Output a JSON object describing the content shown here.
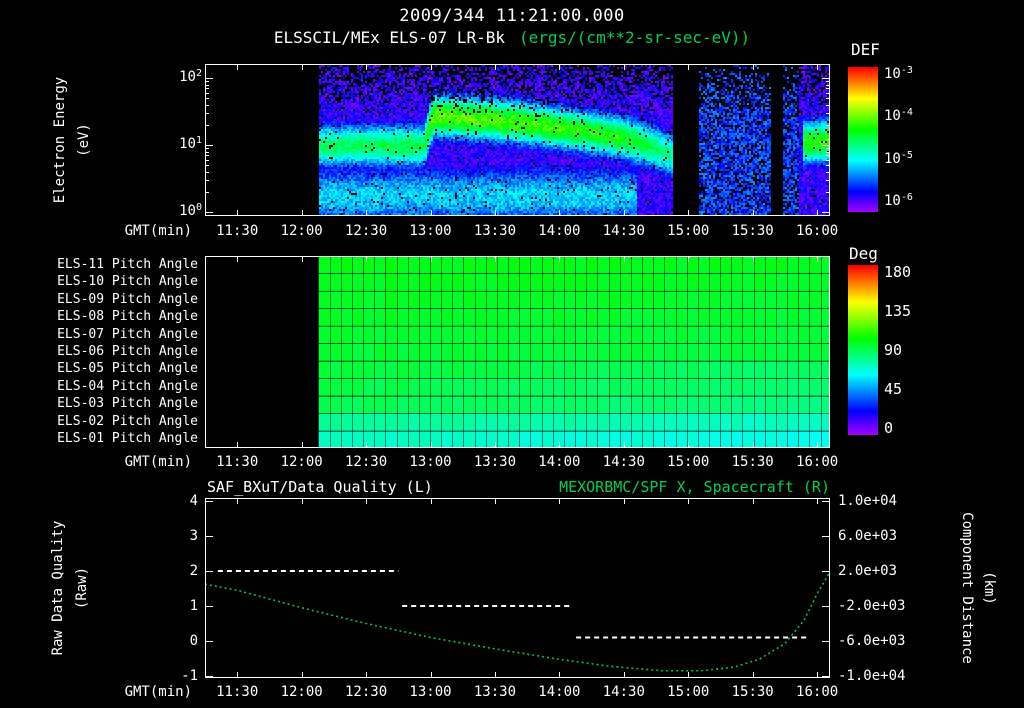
{
  "colors": {
    "background": "#000000",
    "text": "#ffffff",
    "accent_green": "#00cf50",
    "curve_green": "#00c24a",
    "quality_line": "#ffffff"
  },
  "header": {
    "title": "2009/344 11:21:00.000",
    "instrument": "ELSSCIL/MEx ELS-07 LR-Bk",
    "units": "(ergs/(cm**2-sr-sec-eV))"
  },
  "time_axis": {
    "label": "GMT(min)",
    "ticks": [
      "11:30",
      "12:00",
      "12:30",
      "13:00",
      "13:30",
      "14:00",
      "14:30",
      "15:00",
      "15:30",
      "16:00"
    ],
    "tick_hours": [
      11.5,
      12.0,
      12.5,
      13.0,
      13.5,
      14.0,
      14.5,
      15.0,
      15.5,
      16.0
    ],
    "start_hour": 11.25,
    "end_hour": 16.1
  },
  "spectrogram_panel": {
    "ylabel_line1": "Electron Energy",
    "ylabel_line2": "(eV)",
    "yticks": [
      {
        "b": "10",
        "e": "2",
        "logE": 2
      },
      {
        "b": "10",
        "e": "1",
        "logE": 1
      },
      {
        "b": "10",
        "e": "0",
        "logE": 0
      }
    ],
    "colorbar": {
      "title": "DEF",
      "ticks": [
        {
          "b": "10",
          "e": "-3"
        },
        {
          "b": "10",
          "e": "-4"
        },
        {
          "b": "10",
          "e": "-5"
        },
        {
          "b": "10",
          "e": "-6"
        }
      ]
    }
  },
  "pitch_panel": {
    "row_labels": [
      "ELS-11 Pitch Angle",
      "ELS-10 Pitch Angle",
      "ELS-09 Pitch Angle",
      "ELS-08 Pitch Angle",
      "ELS-07 Pitch Angle",
      "ELS-06 Pitch Angle",
      "ELS-05 Pitch Angle",
      "ELS-04 Pitch Angle",
      "ELS-03 Pitch Angle",
      "ELS-02 Pitch Angle",
      "ELS-01 Pitch Angle"
    ],
    "colorbar": {
      "title": "Deg",
      "ticks": [
        "180",
        "135",
        "90",
        "45",
        "0"
      ]
    }
  },
  "quality_panel": {
    "title_left": "SAF_BXuT/Data Quality (L)",
    "title_right": "MEXORBMC/SPF X, Spacecraft (R)",
    "ylabel_left_line1": "Raw Data Quality",
    "ylabel_left_line2": "(Raw)",
    "ylabel_right_line1": "Component Distance",
    "ylabel_right_line2": "(km)",
    "yticks_left": [
      "4",
      "3",
      "2",
      "1",
      "0",
      "-1"
    ],
    "yticks_right": [
      "1.0e+04",
      "6.0e+03",
      "2.0e+03",
      "-2.0e+03",
      "-6.0e+03",
      "-1.0e+04"
    ]
  },
  "chart_data": [
    {
      "type": "heatmap",
      "name": "electron_energy_spectrogram",
      "title": "ELSSCIL/MEx ELS-07 LR-Bk",
      "units": "ergs/(cm**2-sr-sec-eV)",
      "xlabel": "GMT(min)",
      "ylabel": "Electron Energy (eV)",
      "y_scale": "log",
      "y_range_eV": [
        1,
        150
      ],
      "color_scale": "log",
      "color_range": [
        1e-06,
        0.001
      ],
      "colorbar_title": "DEF",
      "axis_start_hour": 11.25,
      "axis_end_hour": 16.1,
      "data_start": "12:08",
      "data_start_hour": 12.13,
      "background_flux": 2e-06,
      "band": {
        "description": "bright electron flux band; steps up near 13:00 then slowly decays",
        "width_dex": 0.32,
        "time_hours": [
          12.13,
          12.95,
          13.02,
          13.55,
          14.05,
          14.5,
          14.88,
          15.08,
          15.55,
          15.88,
          16.1
        ],
        "center_eV": [
          10,
          10,
          28,
          24,
          18,
          13,
          7,
          null,
          null,
          11,
          12
        ],
        "peak_flux": [
          3e-05,
          3.5e-05,
          9e-05,
          8e-05,
          6.5e-05,
          5e-05,
          2e-05,
          null,
          null,
          6e-05,
          7e-05
        ]
      },
      "low_energy_component": {
        "center_logE": 0.25,
        "width_dex": 0.45,
        "u": 0.32,
        "end_hour": 14.6
      },
      "faint_region": {
        "start_hour": 15.08,
        "end_hour": 15.85,
        "flux": 4e-06
      },
      "dropouts": [
        {
          "start_hour": 14.88,
          "end_hour": 15.08
        },
        {
          "start_hour": 15.63,
          "end_hour": 15.72
        }
      ],
      "features": [
        "no data before 12:08",
        "flux dropout ~14:53-15:05",
        "faint blue flux 15:05-15:50",
        "narrow dropout near 15:40",
        "bright green patch near 16:00"
      ]
    },
    {
      "type": "heatmap",
      "name": "pitch_angle_panel",
      "rows": [
        "ELS-11",
        "ELS-10",
        "ELS-09",
        "ELS-08",
        "ELS-07",
        "ELS-06",
        "ELS-05",
        "ELS-04",
        "ELS-03",
        "ELS-02",
        "ELS-01"
      ],
      "units": "Deg",
      "color_range": [
        0,
        180
      ],
      "axis_start_hour": 11.25,
      "axis_end_hour": 16.1,
      "data_start": "12:08",
      "data_start_hour": 12.13,
      "typical_pitch_deg": [
        100,
        99,
        98,
        97,
        96,
        95,
        94,
        92,
        90,
        80,
        74
      ],
      "trend_deg_per_hour_upper_rows": -0.5,
      "trend_deg_per_hour_lower_rows": -1.8,
      "note": "mostly uniform green ~90-100 deg; lowest anodes cyan ~70-80 deg; gridded sector cells"
    },
    {
      "type": "line",
      "name": "quality_and_spacecraft_distance",
      "left_axis": {
        "label": "Raw Data Quality (Raw)",
        "range": [
          -1,
          4
        ]
      },
      "right_axis": {
        "label": "Component Distance (km)",
        "range": [
          -10000,
          10000
        ]
      },
      "axis_start_hour": 11.25,
      "axis_end_hour": 16.1,
      "series": [
        {
          "name": "SAF_BXuT/Data Quality (L)",
          "axis": "left",
          "style": "dashed",
          "color": "#ffffff",
          "segments": [
            {
              "start_hour": 11.35,
              "end_hour": 12.75,
              "value": 2
            },
            {
              "start_hour": 12.78,
              "end_hour": 14.08,
              "value": 1
            },
            {
              "start_hour": 14.13,
              "end_hour": 15.93,
              "value": 0.1
            }
          ]
        },
        {
          "name": "MEXORBMC/SPF X, Spacecraft (R)",
          "axis": "right",
          "style": "dotted",
          "color": "#00c24a",
          "x_hours": [
            11.25,
            11.5,
            12.0,
            12.5,
            13.0,
            13.5,
            14.0,
            14.4,
            14.8,
            15.1,
            15.35,
            15.55,
            15.75,
            15.9,
            16.0,
            16.1
          ],
          "km": [
            500,
            -200,
            -2200,
            -4000,
            -5600,
            -6900,
            -8100,
            -8900,
            -9400,
            -9400,
            -9000,
            -8100,
            -6300,
            -3600,
            -600,
            1900
          ]
        }
      ]
    }
  ]
}
